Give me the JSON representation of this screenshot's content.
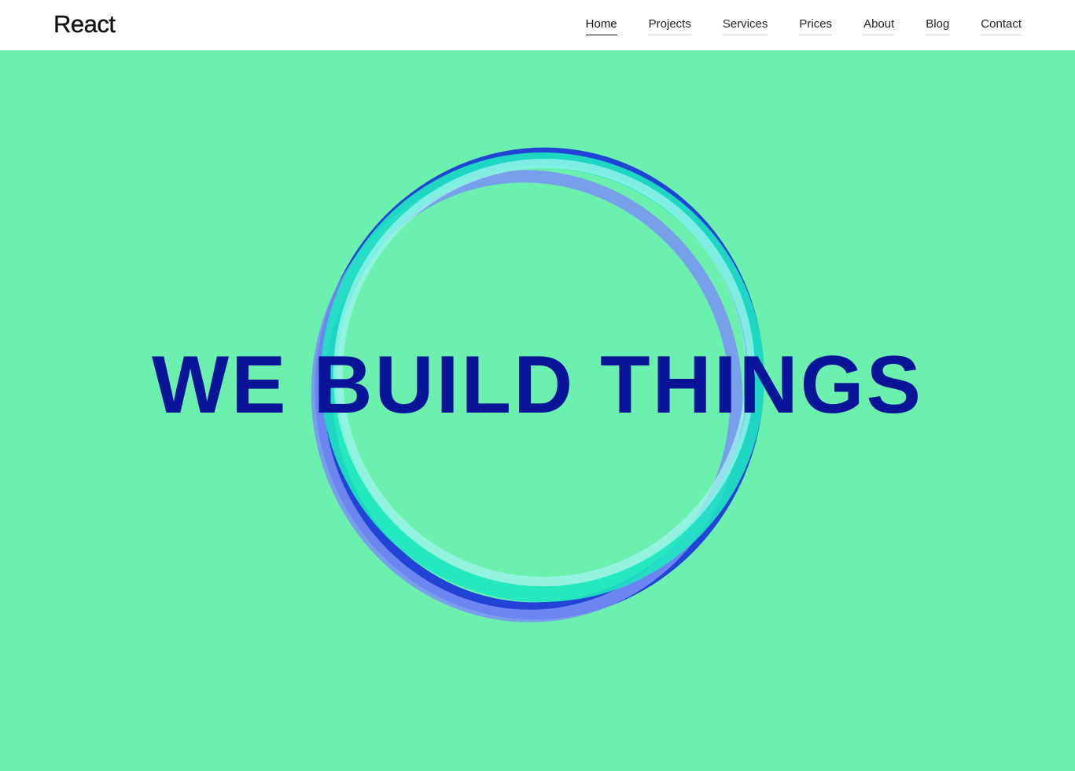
{
  "brand": {
    "name": "React"
  },
  "nav": {
    "items": [
      {
        "label": "Home",
        "active": true
      },
      {
        "label": "Projects",
        "active": false
      },
      {
        "label": "Services",
        "active": false
      },
      {
        "label": "Prices",
        "active": false
      },
      {
        "label": "About",
        "active": false
      },
      {
        "label": "Blog",
        "active": false
      },
      {
        "label": "Contact",
        "active": false
      }
    ]
  },
  "hero": {
    "headline": "WE BUILD THINGS",
    "background_color": "#6bf0ae",
    "headline_color": "#0a1499",
    "ring_colors": [
      "#1f3ad8",
      "#1ee8c0",
      "#a0f4ee",
      "#7a90f4"
    ]
  }
}
